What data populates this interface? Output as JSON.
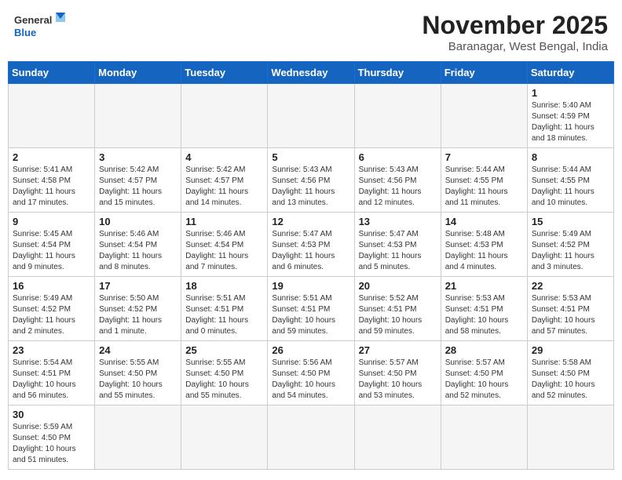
{
  "header": {
    "logo_general": "General",
    "logo_blue": "Blue",
    "month_title": "November 2025",
    "location": "Baranagar, West Bengal, India"
  },
  "weekdays": [
    "Sunday",
    "Monday",
    "Tuesday",
    "Wednesday",
    "Thursday",
    "Friday",
    "Saturday"
  ],
  "weeks": [
    [
      {
        "day": "",
        "info": ""
      },
      {
        "day": "",
        "info": ""
      },
      {
        "day": "",
        "info": ""
      },
      {
        "day": "",
        "info": ""
      },
      {
        "day": "",
        "info": ""
      },
      {
        "day": "",
        "info": ""
      },
      {
        "day": "1",
        "info": "Sunrise: 5:40 AM\nSunset: 4:59 PM\nDaylight: 11 hours and 18 minutes."
      }
    ],
    [
      {
        "day": "2",
        "info": "Sunrise: 5:41 AM\nSunset: 4:58 PM\nDaylight: 11 hours and 17 minutes."
      },
      {
        "day": "3",
        "info": "Sunrise: 5:42 AM\nSunset: 4:57 PM\nDaylight: 11 hours and 15 minutes."
      },
      {
        "day": "4",
        "info": "Sunrise: 5:42 AM\nSunset: 4:57 PM\nDaylight: 11 hours and 14 minutes."
      },
      {
        "day": "5",
        "info": "Sunrise: 5:43 AM\nSunset: 4:56 PM\nDaylight: 11 hours and 13 minutes."
      },
      {
        "day": "6",
        "info": "Sunrise: 5:43 AM\nSunset: 4:56 PM\nDaylight: 11 hours and 12 minutes."
      },
      {
        "day": "7",
        "info": "Sunrise: 5:44 AM\nSunset: 4:55 PM\nDaylight: 11 hours and 11 minutes."
      },
      {
        "day": "8",
        "info": "Sunrise: 5:44 AM\nSunset: 4:55 PM\nDaylight: 11 hours and 10 minutes."
      }
    ],
    [
      {
        "day": "9",
        "info": "Sunrise: 5:45 AM\nSunset: 4:54 PM\nDaylight: 11 hours and 9 minutes."
      },
      {
        "day": "10",
        "info": "Sunrise: 5:46 AM\nSunset: 4:54 PM\nDaylight: 11 hours and 8 minutes."
      },
      {
        "day": "11",
        "info": "Sunrise: 5:46 AM\nSunset: 4:54 PM\nDaylight: 11 hours and 7 minutes."
      },
      {
        "day": "12",
        "info": "Sunrise: 5:47 AM\nSunset: 4:53 PM\nDaylight: 11 hours and 6 minutes."
      },
      {
        "day": "13",
        "info": "Sunrise: 5:47 AM\nSunset: 4:53 PM\nDaylight: 11 hours and 5 minutes."
      },
      {
        "day": "14",
        "info": "Sunrise: 5:48 AM\nSunset: 4:53 PM\nDaylight: 11 hours and 4 minutes."
      },
      {
        "day": "15",
        "info": "Sunrise: 5:49 AM\nSunset: 4:52 PM\nDaylight: 11 hours and 3 minutes."
      }
    ],
    [
      {
        "day": "16",
        "info": "Sunrise: 5:49 AM\nSunset: 4:52 PM\nDaylight: 11 hours and 2 minutes."
      },
      {
        "day": "17",
        "info": "Sunrise: 5:50 AM\nSunset: 4:52 PM\nDaylight: 11 hours and 1 minute."
      },
      {
        "day": "18",
        "info": "Sunrise: 5:51 AM\nSunset: 4:51 PM\nDaylight: 11 hours and 0 minutes."
      },
      {
        "day": "19",
        "info": "Sunrise: 5:51 AM\nSunset: 4:51 PM\nDaylight: 10 hours and 59 minutes."
      },
      {
        "day": "20",
        "info": "Sunrise: 5:52 AM\nSunset: 4:51 PM\nDaylight: 10 hours and 59 minutes."
      },
      {
        "day": "21",
        "info": "Sunrise: 5:53 AM\nSunset: 4:51 PM\nDaylight: 10 hours and 58 minutes."
      },
      {
        "day": "22",
        "info": "Sunrise: 5:53 AM\nSunset: 4:51 PM\nDaylight: 10 hours and 57 minutes."
      }
    ],
    [
      {
        "day": "23",
        "info": "Sunrise: 5:54 AM\nSunset: 4:51 PM\nDaylight: 10 hours and 56 minutes."
      },
      {
        "day": "24",
        "info": "Sunrise: 5:55 AM\nSunset: 4:50 PM\nDaylight: 10 hours and 55 minutes."
      },
      {
        "day": "25",
        "info": "Sunrise: 5:55 AM\nSunset: 4:50 PM\nDaylight: 10 hours and 55 minutes."
      },
      {
        "day": "26",
        "info": "Sunrise: 5:56 AM\nSunset: 4:50 PM\nDaylight: 10 hours and 54 minutes."
      },
      {
        "day": "27",
        "info": "Sunrise: 5:57 AM\nSunset: 4:50 PM\nDaylight: 10 hours and 53 minutes."
      },
      {
        "day": "28",
        "info": "Sunrise: 5:57 AM\nSunset: 4:50 PM\nDaylight: 10 hours and 52 minutes."
      },
      {
        "day": "29",
        "info": "Sunrise: 5:58 AM\nSunset: 4:50 PM\nDaylight: 10 hours and 52 minutes."
      }
    ],
    [
      {
        "day": "30",
        "info": "Sunrise: 5:59 AM\nSunset: 4:50 PM\nDaylight: 10 hours and 51 minutes."
      },
      {
        "day": "",
        "info": ""
      },
      {
        "day": "",
        "info": ""
      },
      {
        "day": "",
        "info": ""
      },
      {
        "day": "",
        "info": ""
      },
      {
        "day": "",
        "info": ""
      },
      {
        "day": "",
        "info": ""
      }
    ]
  ]
}
